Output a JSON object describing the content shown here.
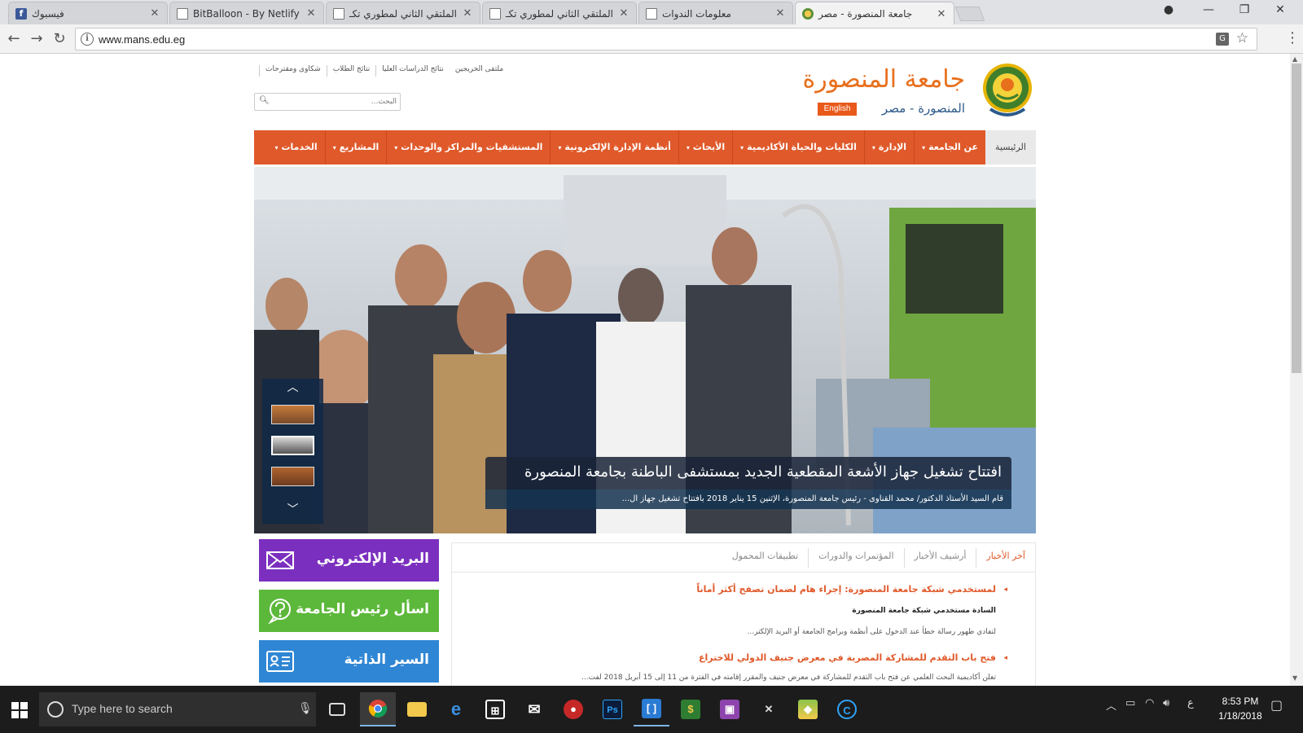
{
  "browser": {
    "tabs": [
      {
        "title": "فيسبوك",
        "icon": "facebook-icon"
      },
      {
        "title": "BitBalloon - By Netlify",
        "icon": "document-icon"
      },
      {
        "title": "الملتقي الثاني لمطوري تكـ",
        "icon": "document-icon"
      },
      {
        "title": "الملتقي الثاني لمطوري تكـ",
        "icon": "document-icon"
      },
      {
        "title": "معلومات الندوات",
        "icon": "document-icon"
      },
      {
        "title": "جامعة المنصورة - مصر",
        "icon": "university-seal-icon",
        "active": true
      }
    ],
    "url": "www.mans.edu.eg"
  },
  "header": {
    "title": "جامعة المنصورة",
    "subtitle": "المنصورة - مصر",
    "english_label": "English",
    "top_links": [
      "شكاوى ومقترحات",
      "نتائج الطلاب",
      "نتائج الدراسات العليا",
      "ملتقى الخريجين"
    ],
    "search_placeholder": "البحث..."
  },
  "nav": {
    "home": "الرئيسية",
    "items": [
      "عن الجامعة",
      "الإدارة",
      "الكليات والحياة الأكاديمية",
      "الأبحاث",
      "أنظمة الإدارة الإلكترونية",
      "المستشفيات والمراكز والوحدات",
      "المشاريع",
      "الخدمات"
    ]
  },
  "slider": {
    "caption": "افتتاح تشغيل جهاز الأشعة المقطعية الجديد بمستشفى الباطنة بجامعة المنصورة",
    "subcaption": "قام السيد الأستاذ الدكتور/ محمد القناوى - رئيس جامعة المنصورة، الإثنين 15 يناير 2018 بافتتاح تشغيل جهاز ال..."
  },
  "side_buttons": [
    {
      "label": "البريد الإلكتروني",
      "color": "#7b2fbf",
      "icon": "envelope-icon"
    },
    {
      "label": "اسأل رئيس الجامعة",
      "color": "#5cb83a",
      "icon": "question-icon"
    },
    {
      "label": "السير الذاتية",
      "color": "#2f86d4",
      "icon": "id-card-icon"
    }
  ],
  "news": {
    "tabs": [
      "آخر الأخبار",
      "أرشيف الأخبار",
      "المؤتمرات والدورات",
      "تطبيقات المحمول"
    ],
    "items": [
      {
        "title": "لمستخدمي شبكة جامعة المنصورة: إجراء هام لضمان تصفح أكثر أماناً",
        "sub": "السادة مستخدمي شبكة جامعة المنصورة",
        "text": "لتفادي ظهور رسالة خطأ عند الدخول على أنظمة وبرامج الجامعة أو البريد الإلكتر..."
      },
      {
        "title": "فتح باب التقدم للمشاركة المصرية في معرض جنيف الدولي للاختراع",
        "text": "تعلن أكاديمية البحث العلمي عن فتح باب التقدم للمشاركة في معرض جنيف والمقرر إقامته في الفترة من 11 إلى 15 أبريل 2018 لفت..."
      }
    ]
  },
  "taskbar": {
    "search_placeholder": "Type here to search",
    "time": "8:53 PM",
    "date": "1/18/2018",
    "lang": "ع"
  }
}
